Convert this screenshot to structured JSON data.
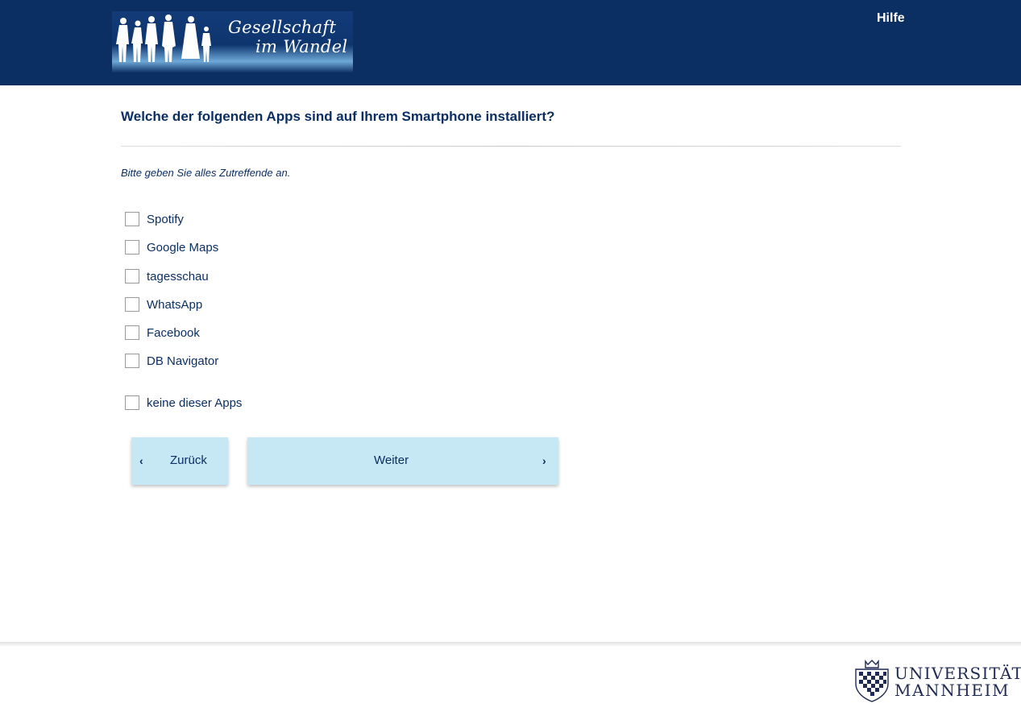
{
  "header": {
    "logo": {
      "line1": "Gesellschaft",
      "line2": "im Wandel"
    },
    "help_label": "Hilfe"
  },
  "question": {
    "title": "Welche der folgenden Apps sind auf Ihrem Smartphone installiert?",
    "instruction": "Bitte geben Sie alles Zutreffende an.",
    "options": [
      {
        "label": "Spotify",
        "checked": false
      },
      {
        "label": "Google Maps",
        "checked": false
      },
      {
        "label": "tagesschau",
        "checked": false
      },
      {
        "label": "WhatsApp",
        "checked": false
      },
      {
        "label": "Facebook",
        "checked": false
      },
      {
        "label": "DB Navigator",
        "checked": false
      }
    ],
    "exclusive_option": {
      "label": "keine dieser Apps",
      "checked": false
    }
  },
  "navigation": {
    "back_label": "Zurück",
    "back_icon": "chevron-left-icon",
    "next_label": "Weiter",
    "next_icon": "chevron-right-icon"
  },
  "footer": {
    "logo_line1": "UNIVERSITÄT",
    "logo_line2": "MANNHEIM"
  },
  "colors": {
    "header_bg": "#0b2f63",
    "text": "#0b2f63",
    "button_bg": "#c6e7f4"
  }
}
